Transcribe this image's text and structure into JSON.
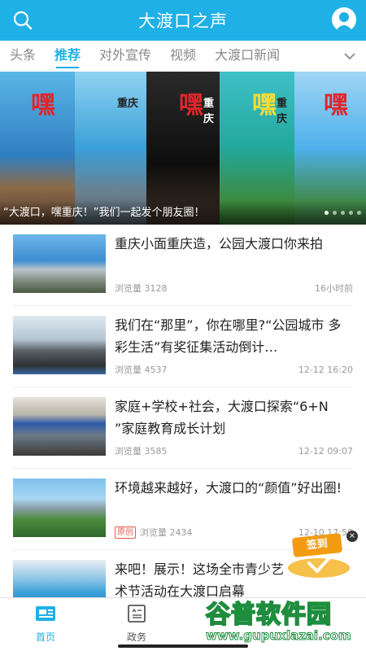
{
  "header": {
    "title": "大渡口之声"
  },
  "tabs": [
    "头条",
    "推荐",
    "对外宣传",
    "视频",
    "大渡口新闻"
  ],
  "active_tab": "推荐",
  "banner": {
    "caption": "“大渡口，嘿重庆！”我们一起发个朋友圈！",
    "panel_brand": "重庆",
    "panel_mark": "嘿",
    "slides": 5,
    "active_slide": 0
  },
  "news": [
    {
      "title": "重庆小面重庆造，公园大渡口你来拍",
      "views": "浏览量 3128",
      "time": "16小时前",
      "badge": ""
    },
    {
      "title": "我们在“那里”，你在哪里?“公园城市 多彩生活”有奖征集活动倒计…",
      "views": "浏览量 4537",
      "time": "12-12 16:20",
      "badge": ""
    },
    {
      "title": "家庭+学校+社会，大渡口探索“6+N ”家庭教育成长计划",
      "views": "浏览量 3585",
      "time": "12-12 09:07",
      "badge": ""
    },
    {
      "title": "环境越来越好，大渡口的“颜值”好出圈!",
      "views": "浏览量 2434",
      "time": "12-10 17:58",
      "badge": "原创"
    },
    {
      "title": "来吧！展示！这场全市青少艺术节活动在大渡口启幕",
      "views": "",
      "time": "",
      "badge": ""
    }
  ],
  "checkin": {
    "label": "签到",
    "close": "×"
  },
  "bottom_nav": [
    {
      "label": "首页"
    },
    {
      "label": "政务"
    }
  ],
  "watermark": {
    "brand": "谷普软件园",
    "url": "www.gupuxlazai.com"
  },
  "colors": {
    "accent": "#1fb0e6",
    "badge": "#e85a50",
    "text": "#222222",
    "meta": "#999999"
  }
}
